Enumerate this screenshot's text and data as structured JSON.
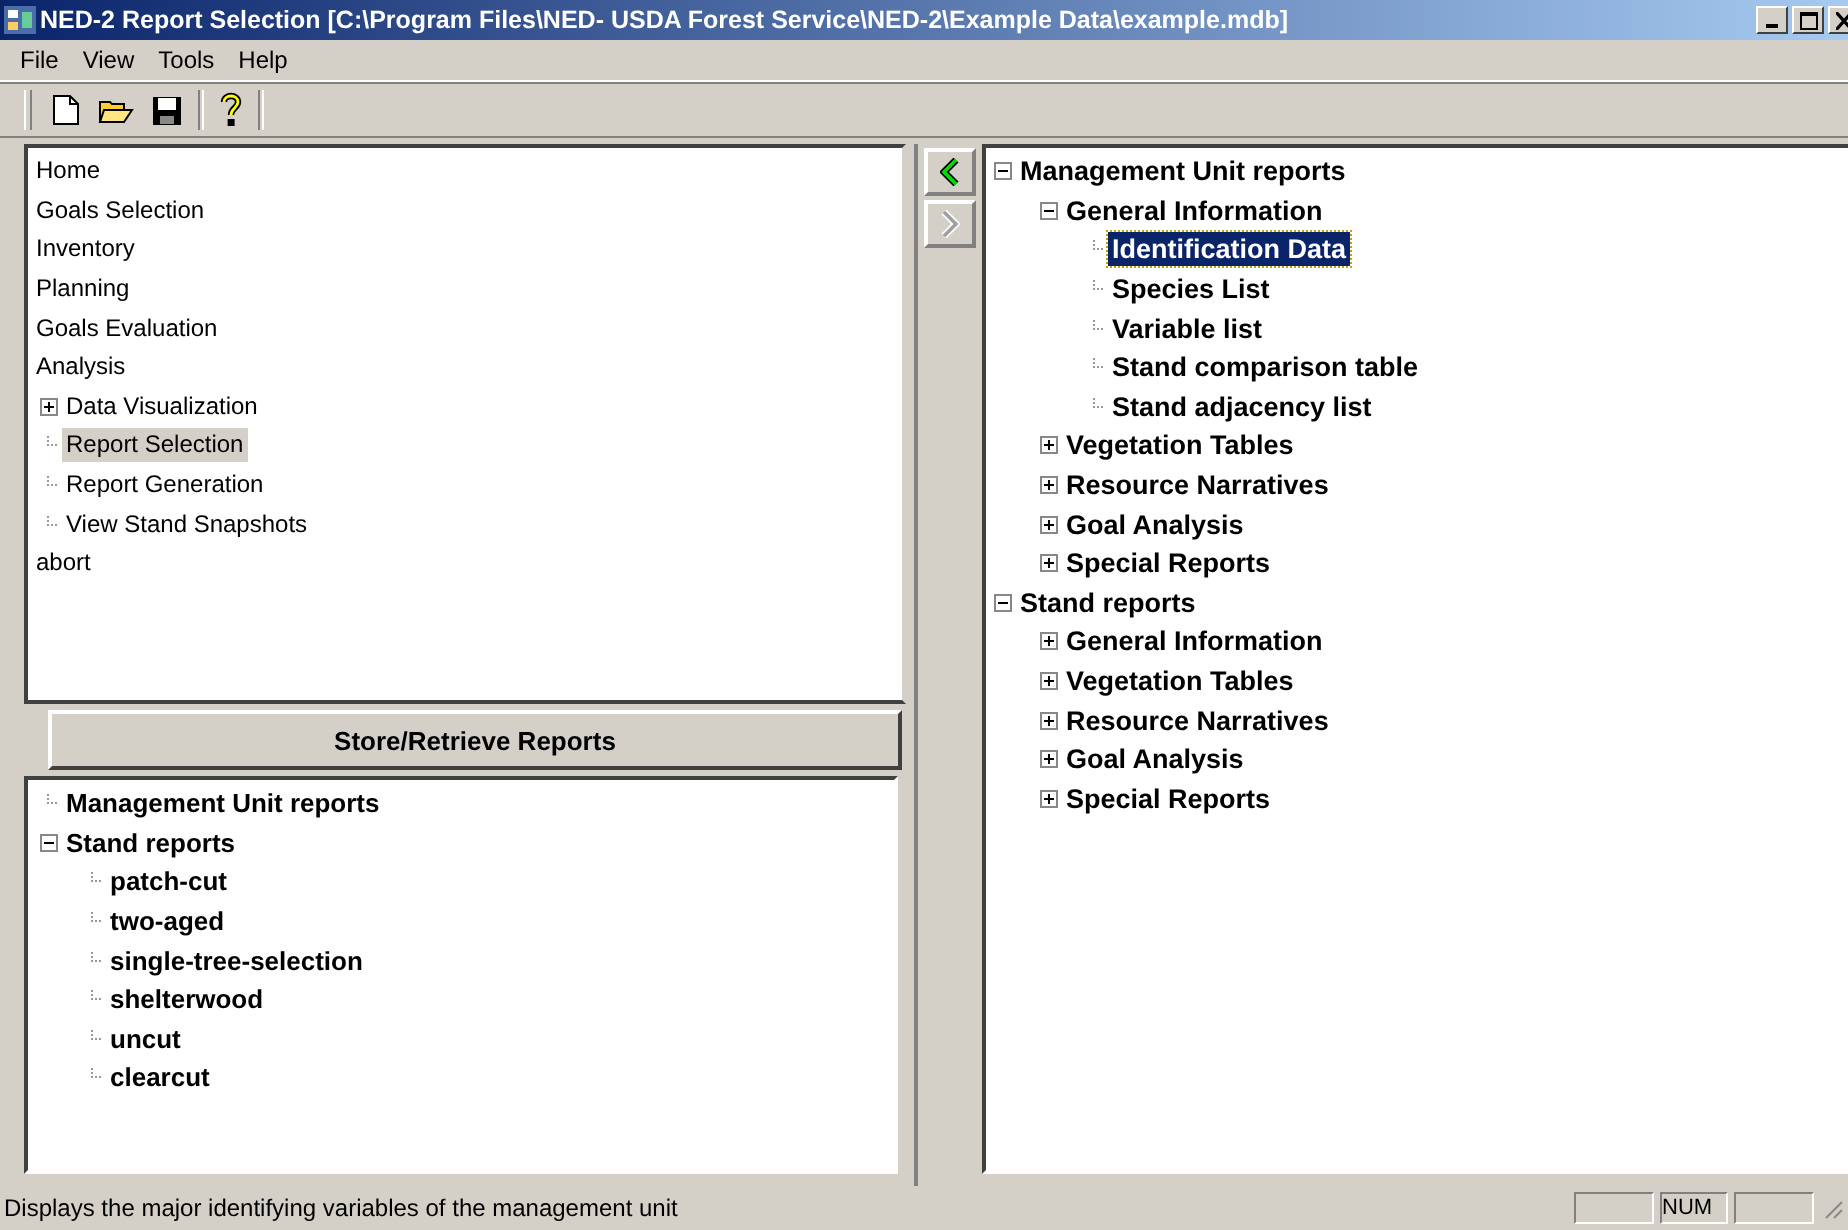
{
  "window": {
    "title": "NED-2 Report Selection  [C:\\Program Files\\NED- USDA Forest Service\\NED-2\\Example Data\\example.mdb]"
  },
  "menu": [
    "File",
    "View",
    "Tools",
    "Help"
  ],
  "nav": [
    {
      "label": "Home",
      "selected": false
    },
    {
      "label": "Goals Selection",
      "selected": false
    },
    {
      "label": "Inventory",
      "selected": false
    },
    {
      "label": "Planning",
      "selected": false
    },
    {
      "label": "Goals Evaluation",
      "selected": false
    },
    {
      "label": "Analysis",
      "selected": false,
      "children": [
        {
          "label": "Data Visualization",
          "kind": "collapsed",
          "selected": false
        },
        {
          "label": "Report Selection",
          "kind": "leaf",
          "selected": true
        },
        {
          "label": "Report Generation",
          "kind": "leaf",
          "selected": false
        },
        {
          "label": "View Stand Snapshots",
          "kind": "leaf",
          "selected": false
        }
      ]
    },
    {
      "label": "abort",
      "selected": false
    }
  ],
  "store_button": "Store/Retrieve Reports",
  "saved_reports": [
    {
      "label": "Management Unit reports",
      "kind": "leaf",
      "selected": false
    },
    {
      "label": "Stand reports",
      "kind": "expanded",
      "selected": false,
      "children": [
        {
          "label": "patch-cut",
          "kind": "leaf",
          "selected": false
        },
        {
          "label": "two-aged",
          "kind": "leaf",
          "selected": false
        },
        {
          "label": "single-tree-selection",
          "kind": "leaf",
          "selected": false
        },
        {
          "label": "shelterwood",
          "kind": "leaf",
          "selected": false
        },
        {
          "label": "uncut",
          "kind": "leaf",
          "selected": false
        },
        {
          "label": "clearcut",
          "kind": "leaf",
          "selected": false
        }
      ]
    }
  ],
  "arrows": [
    {
      "kind": "back",
      "disabled": false
    },
    {
      "kind": "forward",
      "disabled": true
    }
  ],
  "report_tree": [
    {
      "label": "Management Unit reports",
      "kind": "expanded",
      "selected": false,
      "children": [
        {
          "label": "General Information",
          "kind": "expanded",
          "selected": false,
          "children": [
            {
              "label": "Identification Data",
              "kind": "leaf",
              "selected": true
            },
            {
              "label": "Species List",
              "kind": "leaf",
              "selected": false
            },
            {
              "label": "Variable list",
              "kind": "leaf",
              "selected": false
            },
            {
              "label": "Stand comparison table",
              "kind": "leaf",
              "selected": false
            },
            {
              "label": "Stand adjacency list",
              "kind": "leaf",
              "selected": false
            }
          ]
        },
        {
          "label": "Vegetation Tables",
          "kind": "collapsed",
          "selected": false
        },
        {
          "label": "Resource Narratives",
          "kind": "collapsed",
          "selected": false
        },
        {
          "label": "Goal Analysis",
          "kind": "collapsed",
          "selected": false
        },
        {
          "label": "Special Reports",
          "kind": "collapsed",
          "selected": false
        }
      ]
    },
    {
      "label": "Stand reports",
      "kind": "expanded",
      "selected": false,
      "children": [
        {
          "label": "General Information",
          "kind": "collapsed",
          "selected": false
        },
        {
          "label": "Vegetation Tables",
          "kind": "collapsed",
          "selected": false
        },
        {
          "label": "Resource Narratives",
          "kind": "collapsed",
          "selected": false
        },
        {
          "label": "Goal Analysis",
          "kind": "collapsed",
          "selected": false
        },
        {
          "label": "Special Reports",
          "kind": "collapsed",
          "selected": false
        }
      ]
    }
  ],
  "status_bar": {
    "message": "Displays the major identifying variables of the management unit",
    "indicator": "NUM"
  }
}
